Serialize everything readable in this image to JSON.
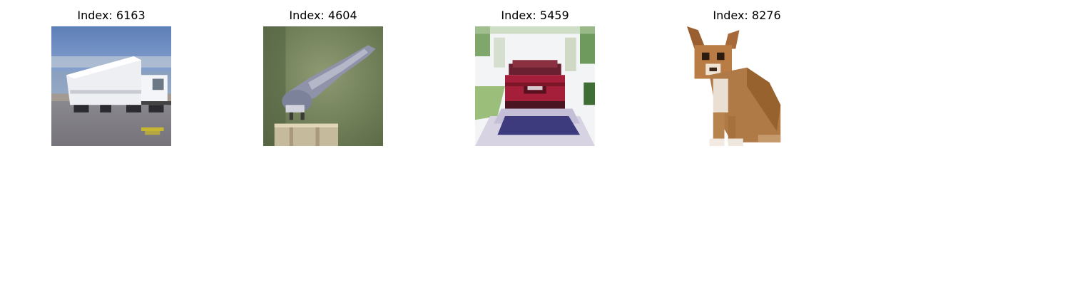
{
  "figure": {
    "panels": [
      {
        "title": "Index: 6163",
        "subject": "truck"
      },
      {
        "title": "Index: 4604",
        "subject": "bird"
      },
      {
        "title": "Index: 5459",
        "subject": "car"
      },
      {
        "title": "Index: 8276",
        "subject": "dog"
      }
    ]
  }
}
